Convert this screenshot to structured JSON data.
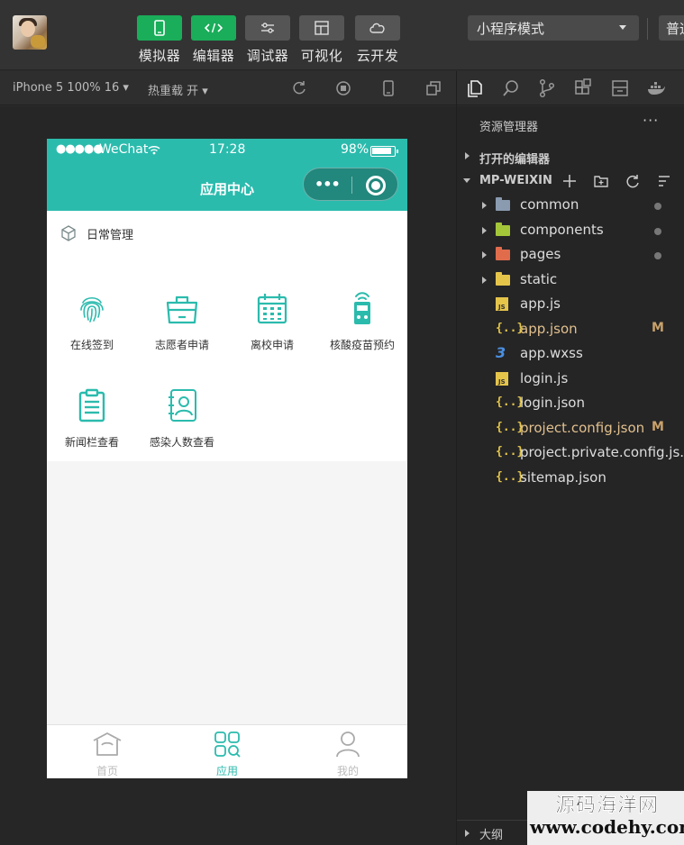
{
  "toolbar": {
    "buttons": [
      {
        "label": "模拟器",
        "icon": "phone-icon",
        "active": true
      },
      {
        "label": "编辑器",
        "icon": "code-icon",
        "active": true
      },
      {
        "label": "调试器",
        "icon": "debug-icon",
        "active": false
      },
      {
        "label": "可视化",
        "icon": "layout-icon",
        "active": false
      },
      {
        "label": "云开发",
        "icon": "cloud-icon",
        "active": false
      }
    ],
    "mode_select": "小程序模式",
    "right_button": "普通"
  },
  "simulator_bar": {
    "device": "iPhone 5 100% 16 ▾",
    "hot_reload": "热重载 开 ▾"
  },
  "phone": {
    "status": {
      "signal": "●●●●●",
      "carrier": "WeChat",
      "time": "17:28",
      "battery": "98%"
    },
    "nav_title": "应用中心",
    "capsule_menu": "•••",
    "section_title": "日常管理",
    "grid": [
      {
        "label": "在线签到",
        "icon": "fingerprint-icon"
      },
      {
        "label": "志愿者申请",
        "icon": "bag-icon"
      },
      {
        "label": "离校申请",
        "icon": "calendar-icon"
      },
      {
        "label": "核酸疫苗预约",
        "icon": "device-icon"
      },
      {
        "label": "新闻栏查看",
        "icon": "clipboard-icon"
      },
      {
        "label": "感染人数查看",
        "icon": "contact-book-icon"
      }
    ],
    "tabs": [
      {
        "label": "首页",
        "icon": "home-icon",
        "active": false
      },
      {
        "label": "应用",
        "icon": "apps-icon",
        "active": true
      },
      {
        "label": "我的",
        "icon": "user-icon",
        "active": false
      }
    ],
    "accent_color": "#2bbbad"
  },
  "explorer": {
    "title": "资源管理器",
    "more": "···",
    "open_editors": "打开的编辑器",
    "project": "MP-WEIXIN",
    "files": [
      {
        "name": "common",
        "type": "folder",
        "color": "#8a9bb0",
        "status": "dot"
      },
      {
        "name": "components",
        "type": "folder",
        "color": "#a4c639",
        "status": "dot"
      },
      {
        "name": "pages",
        "type": "folder",
        "color": "#e06c4c",
        "status": "dot"
      },
      {
        "name": "static",
        "type": "folder",
        "color": "#e5c44a",
        "status": ""
      },
      {
        "name": "app.js",
        "type": "js",
        "status": ""
      },
      {
        "name": "app.json",
        "type": "json",
        "status": "M"
      },
      {
        "name": "app.wxss",
        "type": "css",
        "status": ""
      },
      {
        "name": "login.js",
        "type": "js",
        "status": ""
      },
      {
        "name": "login.json",
        "type": "json",
        "status": ""
      },
      {
        "name": "project.config.json",
        "type": "json",
        "status": "M"
      },
      {
        "name": "project.private.config.js...",
        "type": "json",
        "status": ""
      },
      {
        "name": "sitemap.json",
        "type": "json",
        "status": ""
      }
    ],
    "outline": "大纲"
  },
  "watermark": {
    "line1": "源码海洋网",
    "line2": "www.codehy.com"
  }
}
